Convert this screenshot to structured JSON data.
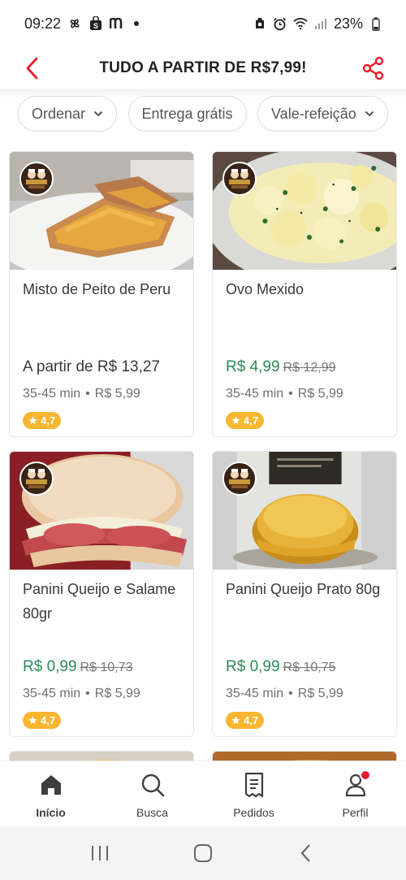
{
  "status_bar": {
    "time": "09:22",
    "battery": "23%",
    "left_icons": [
      "pinwheel-icon",
      "shopping-bag-icon",
      "m-logo-icon",
      "dot-icon"
    ],
    "right_icons": [
      "app-status-icon",
      "alarm-icon",
      "wifi-icon",
      "signal-icon",
      "battery-icon"
    ]
  },
  "header": {
    "title": "TUDO A PARTIR DE R$7,99!",
    "back_icon": "chevron-left-icon",
    "share_icon": "share-icon"
  },
  "filters": [
    {
      "label": "Ordenar",
      "has_dropdown": true
    },
    {
      "label": "Entrega grátis",
      "has_dropdown": false
    },
    {
      "label": "Vale-refeição",
      "has_dropdown": true
    }
  ],
  "products": [
    {
      "name": "Misto de Peito de Peru",
      "price_label": "A partir de R$ 13,27",
      "promo_price": "",
      "old_price": "",
      "delivery_time": "35-45 min",
      "delivery_fee": "R$ 5,99",
      "rating": "4,7"
    },
    {
      "name": "Ovo Mexido",
      "price_label": "",
      "promo_price": "R$ 4,99",
      "old_price": "R$ 12,99",
      "delivery_time": "35-45 min",
      "delivery_fee": "R$ 5,99",
      "rating": "4,7"
    },
    {
      "name": "Panini Queijo e Salame 80gr",
      "price_label": "",
      "promo_price": "R$ 0,99",
      "old_price": "R$ 10,73",
      "delivery_time": "35-45 min",
      "delivery_fee": "R$ 5,99",
      "rating": "4,7"
    },
    {
      "name": "Panini Queijo Prato 80g",
      "price_label": "",
      "promo_price": "R$ 0,99",
      "old_price": "R$ 10,75",
      "delivery_time": "35-45 min",
      "delivery_fee": "R$ 5,99",
      "rating": "4,7"
    }
  ],
  "meta_separator": "•",
  "bottom_nav": [
    {
      "label": "Início",
      "icon": "home-icon",
      "active": true
    },
    {
      "label": "Busca",
      "icon": "search-icon",
      "active": false
    },
    {
      "label": "Pedidos",
      "icon": "receipt-icon",
      "active": false
    },
    {
      "label": "Perfil",
      "icon": "profile-icon",
      "active": false
    }
  ],
  "system_nav": [
    "recent-apps-icon",
    "home-button-icon",
    "back-icon"
  ],
  "colors": {
    "accent": "#EA1D2C",
    "promo_green": "#2E8B57",
    "rating_badge": "#F7B731"
  }
}
